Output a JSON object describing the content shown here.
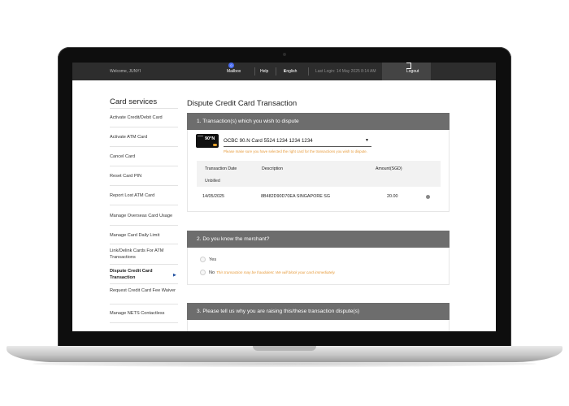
{
  "topbar": {
    "welcome": "Welcome, JUNYI",
    "mailbox_label": "Mailbox",
    "mailbox_count": "0",
    "help": "Help",
    "language": "English",
    "last_login": "Last Login: 14 May 2025 8:14 AM",
    "logout": "Logout"
  },
  "sidebar": {
    "title": "Card services",
    "items": [
      {
        "label": "Activate Credit/Debit Card"
      },
      {
        "label": "Activate ATM Card"
      },
      {
        "label": "Cancel Card"
      },
      {
        "label": "Reset Card PIN"
      },
      {
        "label": "Report Lost ATM Card"
      },
      {
        "label": "Manage Overseas Card Usage"
      },
      {
        "label": "Manage Card Daily Limit"
      },
      {
        "label": "Link/Delink Cards For ATM Transactions"
      },
      {
        "label": "Dispute Credit Card Transaction",
        "active": true
      },
      {
        "label": "Request Credit Card Fee Waiver"
      },
      {
        "label": "Manage NETS Contactless"
      }
    ]
  },
  "main": {
    "page_title": "Dispute Credit Card Transaction",
    "section1": {
      "heading": "1. Transaction(s) which you wish to dispute",
      "card_art_text": "90°N",
      "card_select_value": "OCBC 90.N Card  5524 1234 1234 1234",
      "card_note": "Please make sure you have selected the right card for the transactions you wish to dispute.",
      "table": {
        "headers": {
          "date": "Transaction Date",
          "description": "Description",
          "amount": "Amount(SGD)"
        },
        "group_label": "Unbilled",
        "rows": [
          {
            "date": "14/05/2025",
            "description": "8B482D90D70EA SINGAPORE SG",
            "amount": "20.00"
          }
        ]
      }
    },
    "section2": {
      "heading": "2. Do you know the merchant?",
      "options": [
        {
          "label": "Yes"
        },
        {
          "label": "No"
        }
      ],
      "warning": "This transaction may be fraudulent. We will block your card immediately."
    },
    "section3": {
      "heading": "3. Please tell us why you are raising this/these transaction dispute(s)"
    }
  },
  "colors": {
    "topbar": "#2d2d2d",
    "section_header": "#6d6d6d",
    "warning": "#e69a3a",
    "active_accent": "#1f4fa0"
  }
}
